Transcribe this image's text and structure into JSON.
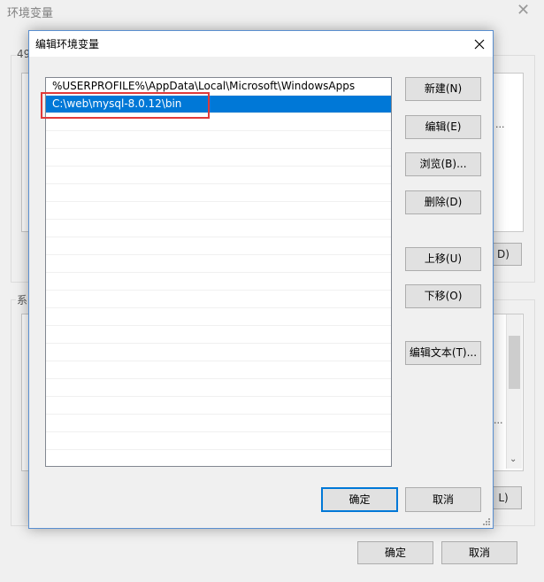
{
  "parent_window": {
    "title": "环境变量",
    "user_group_label_fragment": "49",
    "system_group_label_fragment": "系",
    "user_list_fragment": "...",
    "user_button_fragment": "D)",
    "system_list_fragment": "...",
    "system_button_fragment": "L)",
    "ok_label": "确定",
    "cancel_label": "取消"
  },
  "dialog": {
    "title": "编辑环境变量",
    "paths": [
      {
        "value": "%USERPROFILE%\\AppData\\Local\\Microsoft\\WindowsApps",
        "selected": false
      },
      {
        "value": "C:\\web\\mysql-8.0.12\\bin",
        "selected": true
      }
    ],
    "buttons": {
      "new": "新建(N)",
      "edit": "编辑(E)",
      "browse": "浏览(B)...",
      "delete": "删除(D)",
      "move_up": "上移(U)",
      "move_down": "下移(O)",
      "edit_text": "编辑文本(T)..."
    },
    "ok_label": "确定",
    "cancel_label": "取消"
  },
  "colors": {
    "selection": "#0078d7",
    "annotation_box": "#e03a3a",
    "dialog_border": "#5a8fd0"
  }
}
